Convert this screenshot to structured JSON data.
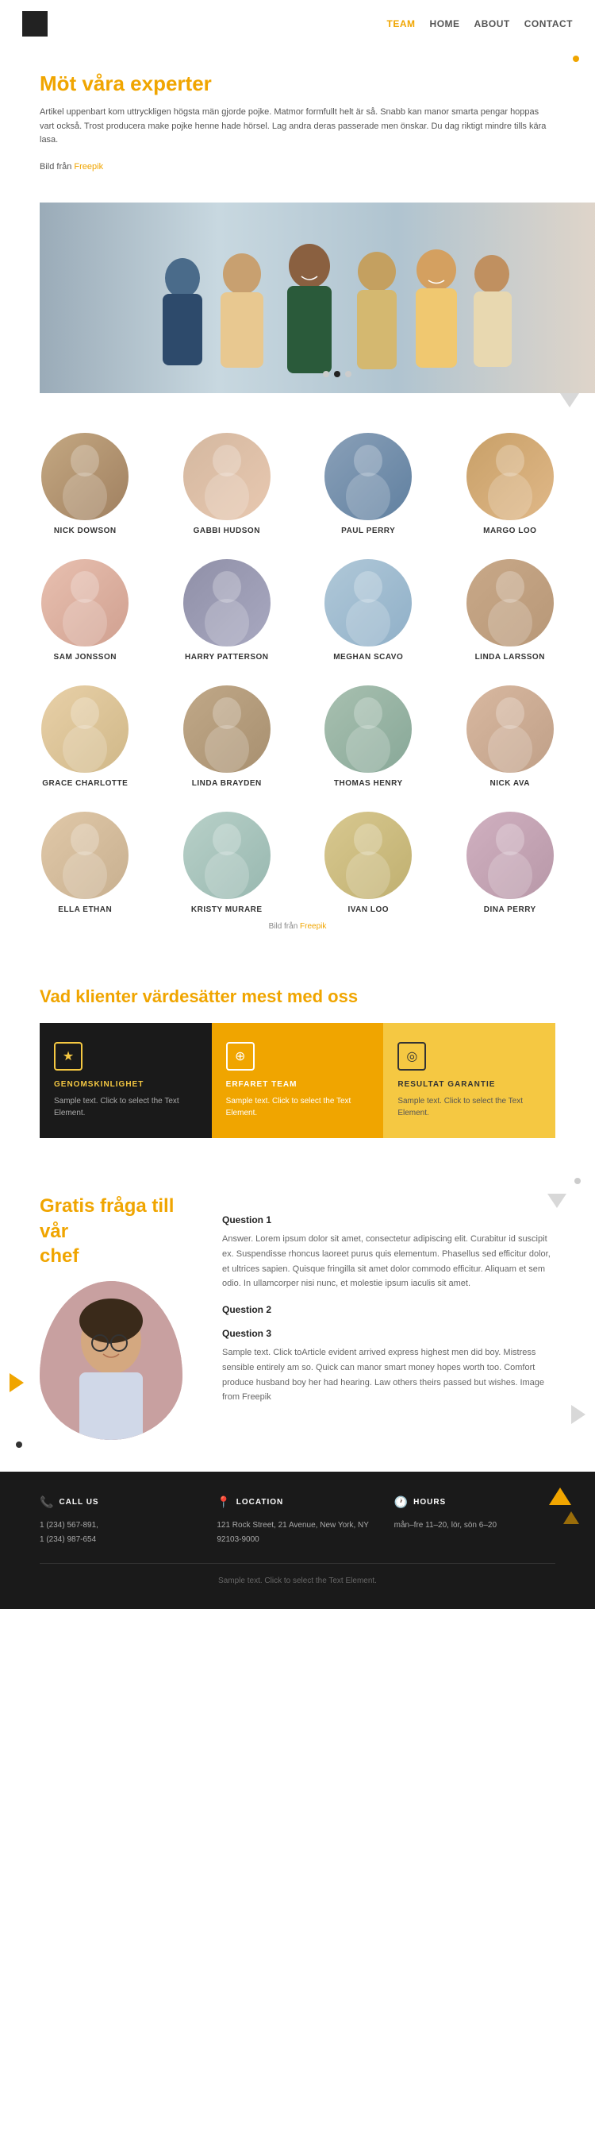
{
  "nav": {
    "team_label": "TEAM",
    "home_label": "HOME",
    "about_label": "ABOUT",
    "contact_label": "CONTACT"
  },
  "hero": {
    "title_plain": "Möt våra ",
    "title_highlight": "experter",
    "paragraph": "Artikel uppenbart kom uttryckligen högsta män gjorde pojke. Matmor formfullt helt är så. Snabb kan manor smarta pengar hoppas vart också. Trost producera make pojke henne hade hörsel. Lag andra deras passerade men önskar. Du dag riktigt mindre tills kära lasa.",
    "credit_text": "Bild från ",
    "credit_link": "Freepik"
  },
  "team": {
    "members": [
      {
        "name": "NICK DOWSON"
      },
      {
        "name": "GABBI HUDSON"
      },
      {
        "name": "PAUL PERRY"
      },
      {
        "name": "MARGO LOO"
      },
      {
        "name": "SAM JONSSON"
      },
      {
        "name": "HARRY PATTERSON"
      },
      {
        "name": "MEGHAN SCAVO"
      },
      {
        "name": "LINDA LARSSON"
      },
      {
        "name": "GRACE CHARLOTTE"
      },
      {
        "name": "LINDA BRAYDEN"
      },
      {
        "name": "THOMAS HENRY"
      },
      {
        "name": "NICK AVA"
      },
      {
        "name": "ELLA ETHAN"
      },
      {
        "name": "KRISTY MURARE"
      },
      {
        "name": "IVAN LOO"
      },
      {
        "name": "DINA PERRY"
      }
    ],
    "credit_text": "Bild från ",
    "credit_link": "Freepik"
  },
  "values": {
    "title_plain": "Vad ",
    "title_highlight": "klienter värdesätter",
    "title_end": " mest med oss",
    "cards": [
      {
        "icon": "★",
        "title": "GENOMSKINLIGHET",
        "text": "Sample text. Click to select the Text Element.",
        "theme": "dark"
      },
      {
        "icon": "⊕",
        "title": "ERFARET TEAM",
        "text": "Sample text. Click to select the Text Element.",
        "theme": "orange"
      },
      {
        "icon": "◎",
        "title": "RESULTAT GARANTIE",
        "text": "Sample text. Click to select the Text Element.",
        "theme": "yellow"
      }
    ]
  },
  "faq": {
    "title_plain": "Gratis fråga till ",
    "title_highlight": "vår",
    "title_end": "chef",
    "questions": [
      {
        "question": "Question 1",
        "answer": "Answer. Lorem ipsum dolor sit amet, consectetur adipiscing elit. Curabitur id suscipit ex. Suspendisse rhoncus laoreet purus quis elementum. Phasellus sed efficitur dolor, et ultrices sapien. Quisque fringilla sit amet dolor commodo efficitur. Aliquam et sem odio. In ullamcorper nisi nunc, et molestie ipsum iaculis sit amet."
      },
      {
        "question": "Question 2",
        "answer": ""
      },
      {
        "question": "Question 3",
        "answer": "Sample text. Click toArticle evident arrived express highest men did boy. Mistress sensible entirely am so. Quick can manor smart money hopes worth too. Comfort produce husband boy her had hearing. Law others theirs passed but wishes. Image from Freepik"
      }
    ]
  },
  "footer": {
    "call_us_label": "CALL US",
    "phone1": "1 (234) 567-891,",
    "phone2": "1 (234) 987-654",
    "location_label": "LOCATION",
    "address": "121 Rock Street, 21 Avenue, New York, NY 92103-9000",
    "hours_label": "HOURS",
    "hours": "mån–fre  11–20, lör, sön  6–20",
    "bottom_text": "Sample text. Click to select the Text Element."
  }
}
